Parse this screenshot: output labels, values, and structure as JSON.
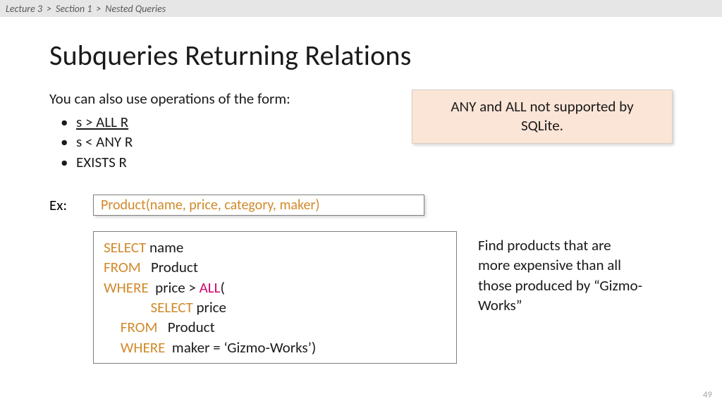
{
  "breadcrumb": {
    "parts": [
      "Lecture 3",
      "Section 1",
      "Nested Queries"
    ],
    "sep": ">"
  },
  "title": "Subqueries Returning Relations",
  "intro": "You can also use operations of the form:",
  "ops": [
    "s > ALL R",
    "s < ANY R",
    "EXISTS R"
  ],
  "note_l1": "ANY and ALL not supported by",
  "note_l2": "SQLite.",
  "ex_label": "Ex:",
  "schema": "Product(name, price, category, maker)",
  "sql": {
    "select": "SELECT",
    "from": "FROM",
    "where": "WHERE",
    "all": "ALL",
    "name": " name",
    "product1": "   Product",
    "price_gt": "  price > ",
    "open": "(",
    "price": " price",
    "product2": "   Product",
    "maker": "  maker = ‘Gizmo-Works’)"
  },
  "explain": "Find products that are more expensive than all those produced by “Gizmo-Works”",
  "page_num": "49"
}
